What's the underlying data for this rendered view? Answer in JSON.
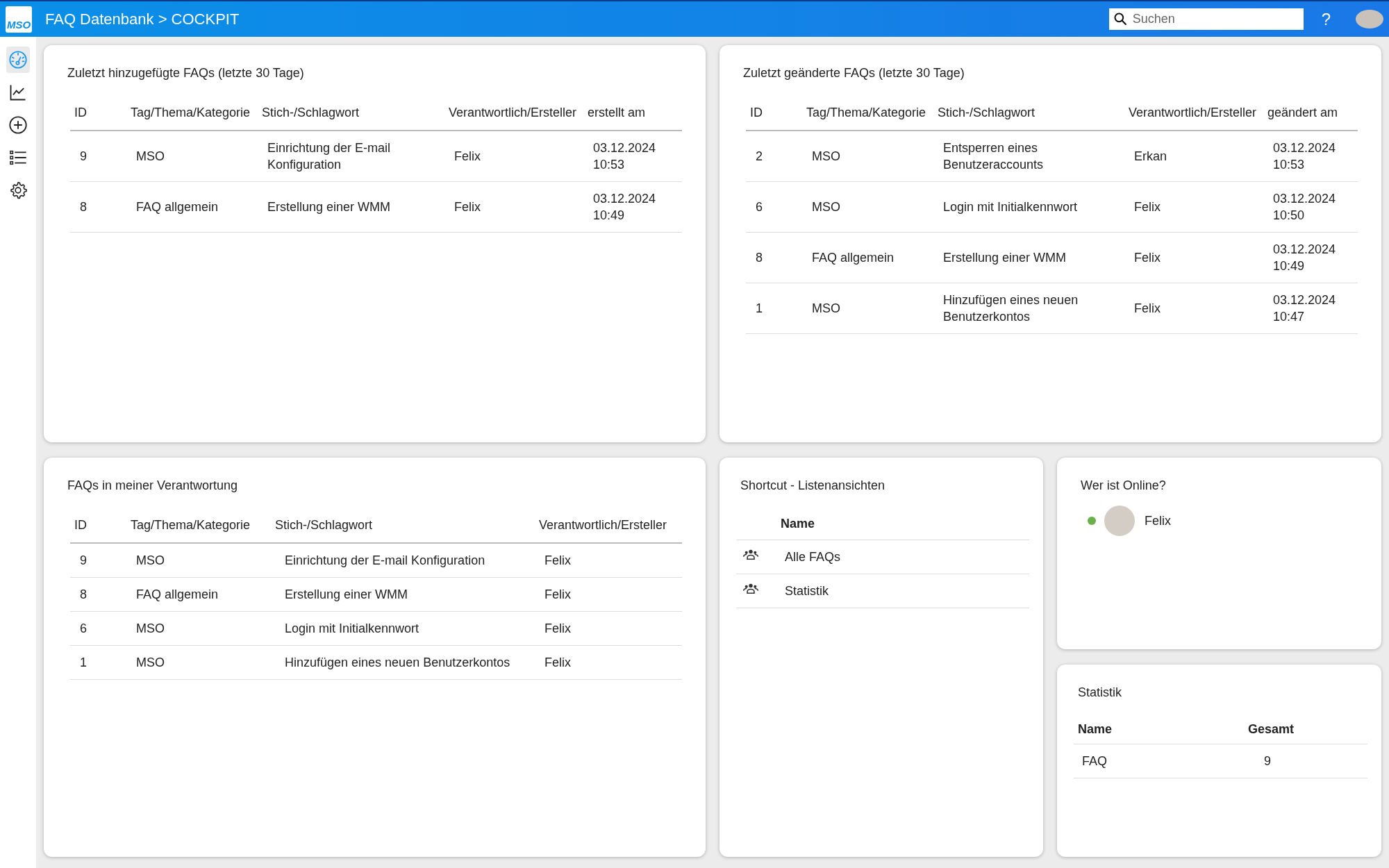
{
  "app": {
    "logo": "MSO",
    "title": "FAQ Datenbank > COCKPIT",
    "search": {
      "placeholder": "Suchen"
    },
    "help": "?"
  },
  "sidebar": {
    "items": [
      {
        "kind": "dashboard",
        "selected": true
      },
      {
        "kind": "chart",
        "selected": false
      },
      {
        "kind": "add",
        "selected": false
      },
      {
        "kind": "list",
        "selected": false
      },
      {
        "kind": "settings",
        "selected": false
      }
    ]
  },
  "recent_added": {
    "title": "Zuletzt hinzugefügte FAQs (letzte 30 Tage)",
    "columns": [
      "ID",
      "Tag/Thema/Kategorie",
      "Stich-/Schlagwort",
      "Verantwortlich/Ersteller",
      "erstellt am"
    ],
    "rows": [
      [
        "9",
        "MSO",
        "Einrichtung der E-mail Konfiguration",
        "Felix",
        "03.12.2024 10:53"
      ],
      [
        "8",
        "FAQ allgemein",
        "Erstellung einer WMM",
        "Felix",
        "03.12.2024 10:49"
      ]
    ]
  },
  "recent_changed": {
    "title": "Zuletzt geänderte FAQs (letzte 30 Tage)",
    "columns": [
      "ID",
      "Tag/Thema/Kategorie",
      "Stich-/Schlagwort",
      "Verantwortlich/Ersteller",
      "geändert am"
    ],
    "rows": [
      [
        "2",
        "MSO",
        "Entsperren eines Benutzeraccounts",
        "Erkan",
        "03.12.2024 10:53"
      ],
      [
        "6",
        "MSO",
        "Login mit Initialkennwort",
        "Felix",
        "03.12.2024 10:50"
      ],
      [
        "8",
        "FAQ allgemein",
        "Erstellung einer WMM",
        "Felix",
        "03.12.2024 10:49"
      ],
      [
        "1",
        "MSO",
        "Hinzufügen eines neuen Benutzerkontos",
        "Felix",
        "03.12.2024 10:47"
      ]
    ]
  },
  "my_faqs": {
    "title": "FAQs in meiner Verantwortung",
    "columns": [
      "ID",
      "Tag/Thema/Kategorie",
      "Stich-/Schlagwort",
      "Verantwortlich/Ersteller"
    ],
    "rows": [
      [
        "9",
        "MSO",
        "Einrichtung der E-mail Konfiguration",
        "Felix"
      ],
      [
        "8",
        "FAQ allgemein",
        "Erstellung einer WMM",
        "Felix"
      ],
      [
        "6",
        "MSO",
        "Login mit Initialkennwort",
        "Felix"
      ],
      [
        "1",
        "MSO",
        "Hinzufügen eines neuen Benutzerkontos",
        "Felix"
      ]
    ]
  },
  "shortcuts": {
    "title": "Shortcut - Listenansichten",
    "column": "Name",
    "items": [
      "Alle FAQs",
      "Statistik"
    ]
  },
  "online": {
    "title": "Wer ist Online?",
    "users": [
      {
        "name": "Felix",
        "online": true
      }
    ]
  },
  "statistics": {
    "title": "Statistik",
    "columns": [
      "Name",
      "Gesamt"
    ],
    "rows": [
      [
        "FAQ",
        "9"
      ]
    ]
  }
}
